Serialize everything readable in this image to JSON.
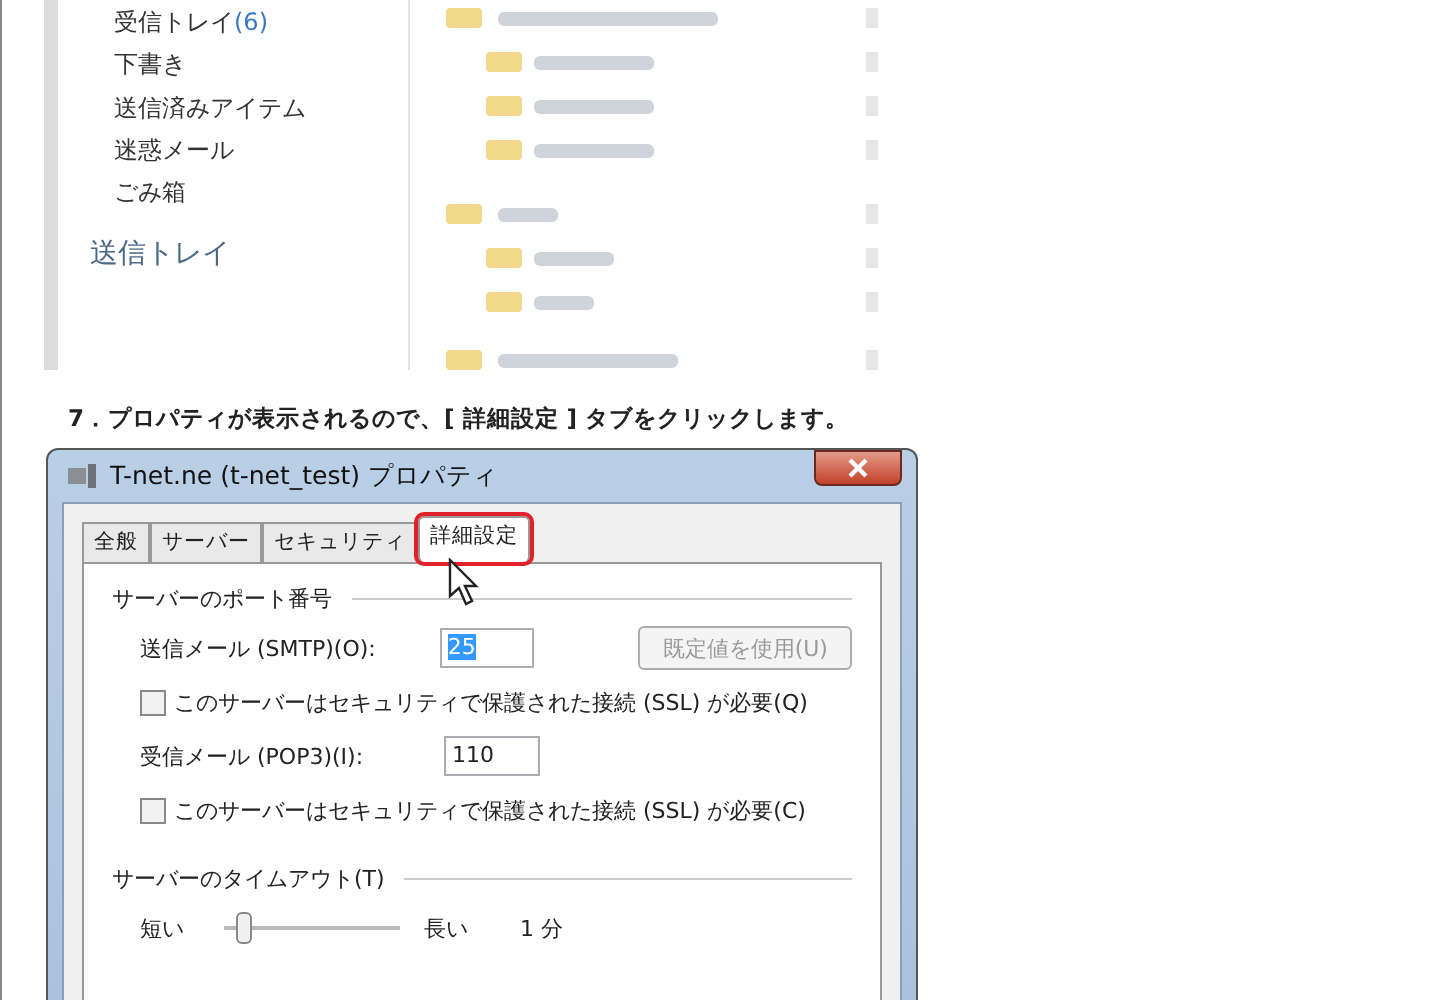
{
  "mail_screenshot": {
    "folders": [
      {
        "label": "受信トレイ",
        "count": "(6)"
      },
      {
        "label": "下書き"
      },
      {
        "label": "送信済みアイテム"
      },
      {
        "label": "迷惑メール"
      },
      {
        "label": "ごみ箱"
      }
    ],
    "outbox": "送信トレイ"
  },
  "instruction": "7．プロパティが表示されるので、[ 詳細設定 ] タブをクリックします。",
  "dialog": {
    "title": "T-net.ne (t-net_test) プロパティ",
    "tabs": [
      {
        "label": "全般",
        "selected": false,
        "highlighted": false
      },
      {
        "label": "サーバー",
        "selected": false,
        "highlighted": false
      },
      {
        "label": "セキュリティ",
        "selected": false,
        "highlighted": false
      },
      {
        "label": "詳細設定",
        "selected": true,
        "highlighted": true
      }
    ],
    "port_section": "サーバーのポート番号",
    "smtp": {
      "label": "送信メール (SMTP)(O):",
      "value": "25",
      "text_selected": true
    },
    "default_button": {
      "label": "既定値を使用(U)",
      "disabled": true
    },
    "smtp_ssl": {
      "label": "このサーバーはセキュリティで保護された接続 (SSL) が必要(Q)",
      "checked": false
    },
    "pop3": {
      "label": "受信メール (POP3)(I):",
      "value": "110",
      "text_selected": false
    },
    "pop3_ssl": {
      "label": "このサーバーはセキュリティで保護された接続 (SSL) が必要(C)",
      "checked": false
    },
    "timeout_section": "サーバーのタイムアウト(T)",
    "timeout": {
      "short_label": "短い",
      "long_label": "長い",
      "level": 0.1,
      "reading": "1 分"
    }
  }
}
